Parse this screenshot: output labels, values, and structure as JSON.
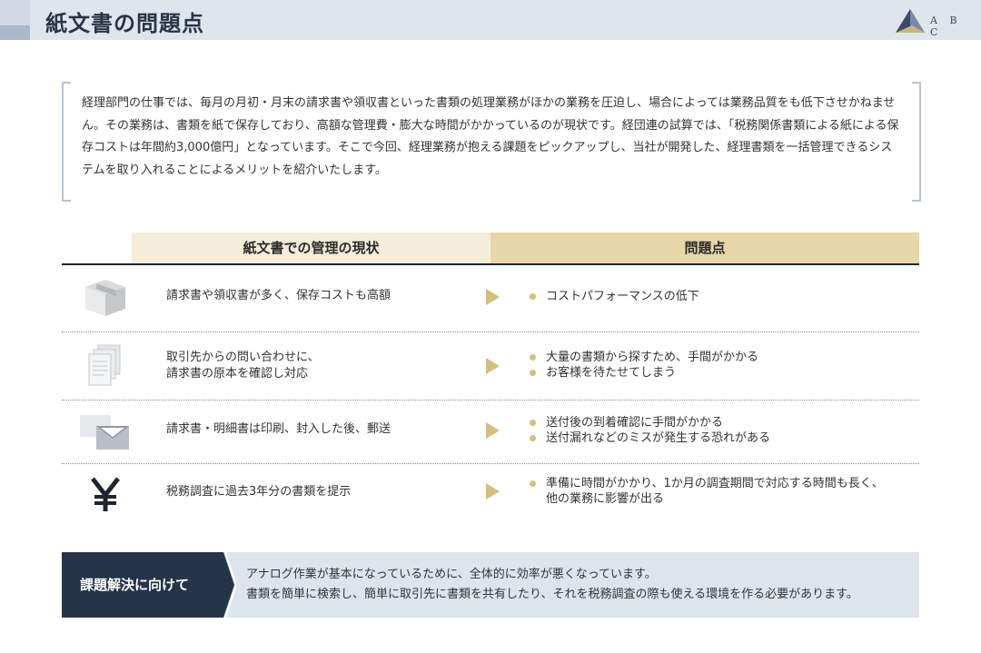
{
  "header": {
    "title": "紙文書の問題点"
  },
  "logo": {
    "text": "A B C"
  },
  "intro": {
    "text": "経理部門の仕事では、毎月の月初・月末の請求書や領収書といった書類の処理業務がほかの業務を圧迫し、場合によっては業務品質をも低下させかねません。その業務は、書類を紙で保存しており、高額な管理費・膨大な時間がかかっているのが現状です。経団連の試算では、「税務関係書類による紙による保存コストは年間約3,000億円」となっています。そこで今回、経理業務が抱える課題をピックアップし、当社が開発した、経理書類を一括管理できるシステムを取り入れることによるメリットを紹介いたします。"
  },
  "table": {
    "headers": [
      "紙文書での管理の現状",
      "問題点"
    ],
    "rows": [
      {
        "icon": "box-icon",
        "desc": [
          "請求書や領収書が多く、保存コストも高額"
        ],
        "issues": [
          "コストパフォーマンスの低下"
        ]
      },
      {
        "icon": "documents-icon",
        "desc": [
          "取引先からの問い合わせに、",
          "請求書の原本を確認し対応"
        ],
        "issues": [
          "大量の書類から探すため、手間がかかる",
          "お客様を待たせてしまう"
        ]
      },
      {
        "icon": "envelope-icon",
        "desc": [
          "請求書・明細書は印刷、封入した後、郵送"
        ],
        "issues": [
          "送付後の到着確認に手間がかかる",
          "送付漏れなどのミスが発生する恐れがある"
        ]
      },
      {
        "icon": "yen-icon",
        "desc": [
          "税務調査に過去3年分の書類を提示"
        ],
        "issues": [
          "準備に時間がかかり、1か月の調査期間で対応する時間も長く、",
          "他の業務に影響が出る"
        ]
      }
    ]
  },
  "solution": {
    "label": "課題解決に向けて",
    "lines": [
      "アナログ作業が基本になっているために、全体的に効率が悪くなっています。",
      "書類を簡単に検索し、簡単に取引先に書類を共有したり、それを税務調査の際も使える環境を作る必要があります。"
    ]
  },
  "colors": {
    "navy": "#26344a",
    "gold": "#d5bf7c",
    "header_bg": "#dfe5ed",
    "band_bg": "#dde4ec"
  }
}
